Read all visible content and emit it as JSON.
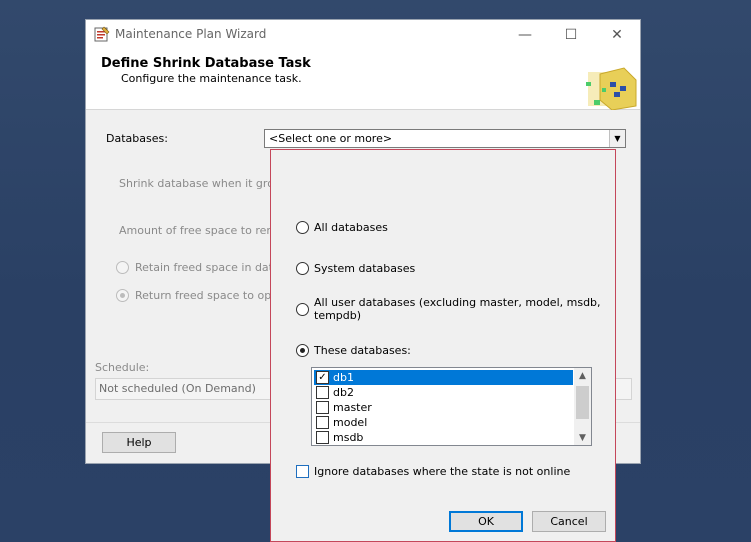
{
  "window": {
    "title": "Maintenance Plan Wizard",
    "minimize": "—",
    "maximize": "☐",
    "close": "✕"
  },
  "header": {
    "title": "Define Shrink Database Task",
    "subtitle": "Configure the maintenance task."
  },
  "form": {
    "databases_label": "Databases:",
    "databases_value": "<Select one or more>",
    "shrink_label": "Shrink database when it grows b",
    "free_space_label": "Amount of free space to remain a",
    "retain_label": "Retain freed space in databa",
    "return_label": "Return freed space to operat",
    "schedule_label": "Schedule:",
    "schedule_value": "Not scheduled (On Demand)",
    "help_button": "Help"
  },
  "popup": {
    "all_databases": "All databases",
    "system_databases": "System databases",
    "all_user_databases_line1": "All user databases  (excluding master, model, msdb,",
    "all_user_databases_line2": "tempdb)",
    "these_databases": "These databases:",
    "selected_option": "These databases",
    "databases": [
      {
        "name": "db1",
        "checked": true,
        "selected": true
      },
      {
        "name": "db2",
        "checked": false,
        "selected": false
      },
      {
        "name": "master",
        "checked": false,
        "selected": false
      },
      {
        "name": "model",
        "checked": false,
        "selected": false
      },
      {
        "name": "msdb",
        "checked": false,
        "selected": false
      }
    ],
    "ignore_offline": "Ignore databases where the state is not online",
    "ok_button": "OK",
    "cancel_button": "Cancel"
  },
  "colors": {
    "accent": "#0078d7",
    "popup_border": "#c4475a",
    "desktop": "#2c4467"
  }
}
